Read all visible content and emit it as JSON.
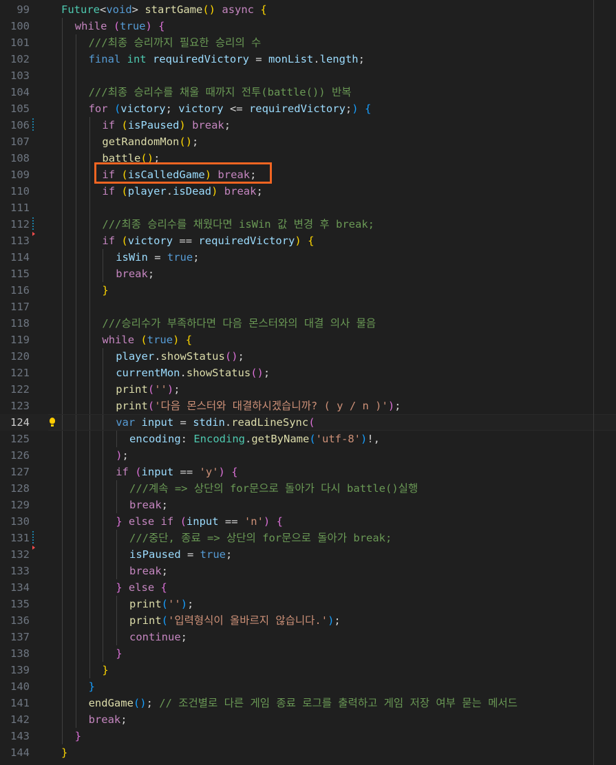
{
  "editor": {
    "current_line": 124,
    "lines": [
      {
        "n": "99",
        "indent": 0,
        "tokens": [
          [
            "t",
            "Future"
          ],
          [
            "p",
            "<"
          ],
          [
            "k",
            "void"
          ],
          [
            "p",
            "> "
          ],
          [
            "f",
            "startGame"
          ],
          [
            "b1",
            "()"
          ],
          [
            "p",
            " "
          ],
          [
            "c",
            "async"
          ],
          [
            "p",
            " "
          ],
          [
            "b1",
            "{"
          ]
        ]
      },
      {
        "n": "100",
        "indent": 1,
        "tokens": [
          [
            "c",
            "while"
          ],
          [
            "p",
            " "
          ],
          [
            "b2",
            "("
          ],
          [
            "k",
            "true"
          ],
          [
            "b2",
            ")"
          ],
          [
            "p",
            " "
          ],
          [
            "b2",
            "{"
          ]
        ]
      },
      {
        "n": "101",
        "indent": 2,
        "tokens": [
          [
            "m",
            "///최종 승리까지 필요한 승리의 수"
          ]
        ]
      },
      {
        "n": "102",
        "indent": 2,
        "tokens": [
          [
            "k",
            "final"
          ],
          [
            "p",
            " "
          ],
          [
            "t",
            "int"
          ],
          [
            "p",
            " "
          ],
          [
            "v",
            "requiredVictory"
          ],
          [
            "p",
            " = "
          ],
          [
            "v",
            "monList"
          ],
          [
            "p",
            "."
          ],
          [
            "v",
            "length"
          ],
          [
            "p",
            ";"
          ]
        ]
      },
      {
        "n": "103",
        "indent": 2,
        "tokens": []
      },
      {
        "n": "104",
        "indent": 2,
        "tokens": [
          [
            "m",
            "///최종 승리수를 채울 때까지 전투(battle()) 반복"
          ]
        ]
      },
      {
        "n": "105",
        "indent": 2,
        "tokens": [
          [
            "c",
            "for"
          ],
          [
            "p",
            " "
          ],
          [
            "b3",
            "("
          ],
          [
            "v",
            "victory"
          ],
          [
            "p",
            "; "
          ],
          [
            "v",
            "victory"
          ],
          [
            "p",
            " <= "
          ],
          [
            "v",
            "requiredVictory"
          ],
          [
            "p",
            ";"
          ],
          [
            "b3",
            ")"
          ],
          [
            "p",
            " "
          ],
          [
            "b3",
            "{"
          ]
        ]
      },
      {
        "n": "106",
        "indent": 3,
        "mod": true,
        "tokens": [
          [
            "c",
            "if"
          ],
          [
            "p",
            " "
          ],
          [
            "b1",
            "("
          ],
          [
            "v",
            "isPaused"
          ],
          [
            "b1",
            ")"
          ],
          [
            "p",
            " "
          ],
          [
            "c",
            "break"
          ],
          [
            "p",
            ";"
          ]
        ]
      },
      {
        "n": "107",
        "indent": 3,
        "tokens": [
          [
            "f",
            "getRandomMon"
          ],
          [
            "b1",
            "()"
          ],
          [
            "p",
            ";"
          ]
        ]
      },
      {
        "n": "108",
        "indent": 3,
        "tokens": [
          [
            "f",
            "battle"
          ],
          [
            "b1",
            "()"
          ],
          [
            "p",
            ";"
          ]
        ]
      },
      {
        "n": "109",
        "indent": 3,
        "tokens": [
          [
            "c",
            "if"
          ],
          [
            "p",
            " "
          ],
          [
            "b1",
            "("
          ],
          [
            "v",
            "isCalledGame"
          ],
          [
            "b1",
            ")"
          ],
          [
            "p",
            " "
          ],
          [
            "c",
            "break"
          ],
          [
            "p",
            ";"
          ]
        ]
      },
      {
        "n": "110",
        "indent": 3,
        "tokens": [
          [
            "c",
            "if"
          ],
          [
            "p",
            " "
          ],
          [
            "b1",
            "("
          ],
          [
            "v",
            "player"
          ],
          [
            "p",
            "."
          ],
          [
            "v",
            "isDead"
          ],
          [
            "b1",
            ")"
          ],
          [
            "p",
            " "
          ],
          [
            "c",
            "break"
          ],
          [
            "p",
            ";"
          ]
        ]
      },
      {
        "n": "111",
        "indent": 3,
        "tokens": []
      },
      {
        "n": "112",
        "indent": 3,
        "mod": true,
        "tokens": [
          [
            "m",
            "///최종 승리수를 채웠다면 isWin 값 변경 후 break;"
          ]
        ]
      },
      {
        "n": "113",
        "indent": 3,
        "del": true,
        "tokens": [
          [
            "c",
            "if"
          ],
          [
            "p",
            " "
          ],
          [
            "b1",
            "("
          ],
          [
            "v",
            "victory"
          ],
          [
            "p",
            " == "
          ],
          [
            "v",
            "requiredVictory"
          ],
          [
            "b1",
            ")"
          ],
          [
            "p",
            " "
          ],
          [
            "b1",
            "{"
          ]
        ]
      },
      {
        "n": "114",
        "indent": 4,
        "tokens": [
          [
            "v",
            "isWin"
          ],
          [
            "p",
            " = "
          ],
          [
            "k",
            "true"
          ],
          [
            "p",
            ";"
          ]
        ]
      },
      {
        "n": "115",
        "indent": 4,
        "tokens": [
          [
            "c",
            "break"
          ],
          [
            "p",
            ";"
          ]
        ]
      },
      {
        "n": "116",
        "indent": 3,
        "tokens": [
          [
            "b1",
            "}"
          ]
        ]
      },
      {
        "n": "117",
        "indent": 3,
        "tokens": []
      },
      {
        "n": "118",
        "indent": 3,
        "tokens": [
          [
            "m",
            "///승리수가 부족하다면 다음 몬스터와의 대결 의사 물음"
          ]
        ]
      },
      {
        "n": "119",
        "indent": 3,
        "tokens": [
          [
            "c",
            "while"
          ],
          [
            "p",
            " "
          ],
          [
            "b1",
            "("
          ],
          [
            "k",
            "true"
          ],
          [
            "b1",
            ")"
          ],
          [
            "p",
            " "
          ],
          [
            "b1",
            "{"
          ]
        ]
      },
      {
        "n": "120",
        "indent": 4,
        "tokens": [
          [
            "v",
            "player"
          ],
          [
            "p",
            "."
          ],
          [
            "f",
            "showStatus"
          ],
          [
            "b2",
            "()"
          ],
          [
            "p",
            ";"
          ]
        ]
      },
      {
        "n": "121",
        "indent": 4,
        "tokens": [
          [
            "v",
            "currentMon"
          ],
          [
            "p",
            "."
          ],
          [
            "f",
            "showStatus"
          ],
          [
            "b2",
            "()"
          ],
          [
            "p",
            ";"
          ]
        ]
      },
      {
        "n": "122",
        "indent": 4,
        "tokens": [
          [
            "f",
            "print"
          ],
          [
            "b2",
            "("
          ],
          [
            "s",
            "''"
          ],
          [
            "b2",
            ")"
          ],
          [
            "p",
            ";"
          ]
        ]
      },
      {
        "n": "123",
        "indent": 4,
        "tokens": [
          [
            "f",
            "print"
          ],
          [
            "b2",
            "("
          ],
          [
            "s",
            "'다음 몬스터와 대결하시겠습니까? ( y / n )'"
          ],
          [
            "b2",
            ")"
          ],
          [
            "p",
            ";"
          ]
        ]
      },
      {
        "n": "124",
        "indent": 4,
        "bulb": true,
        "tokens": [
          [
            "k",
            "var"
          ],
          [
            "p",
            " "
          ],
          [
            "v",
            "input"
          ],
          [
            "p",
            " = "
          ],
          [
            "v",
            "stdin"
          ],
          [
            "p",
            "."
          ],
          [
            "f",
            "readLineSync"
          ],
          [
            "b2",
            "("
          ]
        ]
      },
      {
        "n": "125",
        "indent": 5,
        "tokens": [
          [
            "v",
            "encoding"
          ],
          [
            "p",
            ": "
          ],
          [
            "t",
            "Encoding"
          ],
          [
            "p",
            "."
          ],
          [
            "f",
            "getByName"
          ],
          [
            "b3",
            "("
          ],
          [
            "s",
            "'utf-8'"
          ],
          [
            "b3",
            ")"
          ],
          [
            "p",
            "!,"
          ]
        ]
      },
      {
        "n": "126",
        "indent": 4,
        "tokens": [
          [
            "b2",
            ")"
          ],
          [
            "p",
            ";"
          ]
        ]
      },
      {
        "n": "127",
        "indent": 4,
        "tokens": [
          [
            "c",
            "if"
          ],
          [
            "p",
            " "
          ],
          [
            "b2",
            "("
          ],
          [
            "v",
            "input"
          ],
          [
            "p",
            " == "
          ],
          [
            "s",
            "'y'"
          ],
          [
            "b2",
            ")"
          ],
          [
            "p",
            " "
          ],
          [
            "b2",
            "{"
          ]
        ]
      },
      {
        "n": "128",
        "indent": 5,
        "tokens": [
          [
            "m",
            "///계속 => 상단의 for문으로 돌아가 다시 battle()실행"
          ]
        ]
      },
      {
        "n": "129",
        "indent": 5,
        "tokens": [
          [
            "c",
            "break"
          ],
          [
            "p",
            ";"
          ]
        ]
      },
      {
        "n": "130",
        "indent": 4,
        "tokens": [
          [
            "b2",
            "}"
          ],
          [
            "p",
            " "
          ],
          [
            "c",
            "else"
          ],
          [
            "p",
            " "
          ],
          [
            "c",
            "if"
          ],
          [
            "p",
            " "
          ],
          [
            "b2",
            "("
          ],
          [
            "v",
            "input"
          ],
          [
            "p",
            " == "
          ],
          [
            "s",
            "'n'"
          ],
          [
            "b2",
            ")"
          ],
          [
            "p",
            " "
          ],
          [
            "b2",
            "{"
          ]
        ]
      },
      {
        "n": "131",
        "indent": 5,
        "mod": true,
        "tokens": [
          [
            "m",
            "///중단, 종료 => 상단의 for문으로 돌아가 break;"
          ]
        ]
      },
      {
        "n": "132",
        "indent": 5,
        "del": true,
        "tokens": [
          [
            "v",
            "isPaused"
          ],
          [
            "p",
            " = "
          ],
          [
            "k",
            "true"
          ],
          [
            "p",
            ";"
          ]
        ]
      },
      {
        "n": "133",
        "indent": 5,
        "tokens": [
          [
            "c",
            "break"
          ],
          [
            "p",
            ";"
          ]
        ]
      },
      {
        "n": "134",
        "indent": 4,
        "tokens": [
          [
            "b2",
            "}"
          ],
          [
            "p",
            " "
          ],
          [
            "c",
            "else"
          ],
          [
            "p",
            " "
          ],
          [
            "b2",
            "{"
          ]
        ]
      },
      {
        "n": "135",
        "indent": 5,
        "tokens": [
          [
            "f",
            "print"
          ],
          [
            "b3",
            "("
          ],
          [
            "s",
            "''"
          ],
          [
            "b3",
            ")"
          ],
          [
            "p",
            ";"
          ]
        ]
      },
      {
        "n": "136",
        "indent": 5,
        "tokens": [
          [
            "f",
            "print"
          ],
          [
            "b3",
            "("
          ],
          [
            "s",
            "'입력형식이 올바르지 않습니다.'"
          ],
          [
            "b3",
            ")"
          ],
          [
            "p",
            ";"
          ]
        ]
      },
      {
        "n": "137",
        "indent": 5,
        "tokens": [
          [
            "c",
            "continue"
          ],
          [
            "p",
            ";"
          ]
        ]
      },
      {
        "n": "138",
        "indent": 4,
        "tokens": [
          [
            "b2",
            "}"
          ]
        ]
      },
      {
        "n": "139",
        "indent": 3,
        "tokens": [
          [
            "b1",
            "}"
          ]
        ]
      },
      {
        "n": "140",
        "indent": 2,
        "tokens": [
          [
            "b3",
            "}"
          ]
        ]
      },
      {
        "n": "141",
        "indent": 2,
        "tokens": [
          [
            "f",
            "endGame"
          ],
          [
            "b3",
            "()"
          ],
          [
            "p",
            "; "
          ],
          [
            "m",
            "// 조건별로 다른 게임 종료 로그를 출력하고 게임 저장 여부 묻는 메서드"
          ]
        ]
      },
      {
        "n": "142",
        "indent": 2,
        "tokens": [
          [
            "c",
            "break"
          ],
          [
            "p",
            ";"
          ]
        ]
      },
      {
        "n": "143",
        "indent": 1,
        "tokens": [
          [
            "b2",
            "}"
          ]
        ]
      },
      {
        "n": "144",
        "indent": 0,
        "tokens": [
          [
            "b1",
            "}"
          ]
        ]
      }
    ]
  },
  "colors": {
    "background": "#1f1f1f",
    "highlight_box": "#f26522",
    "keyword": "#569cd6",
    "control": "#c586c0",
    "function": "#dcdcaa",
    "variable": "#9cdcfe",
    "type": "#4ec9b0",
    "string": "#ce9178",
    "comment": "#6a9955"
  },
  "annotations": {
    "highlight": "red-orange box around 'if (isCalledGame) break;' on line 109",
    "lightbulb_icon": "lightbulb-icon"
  }
}
